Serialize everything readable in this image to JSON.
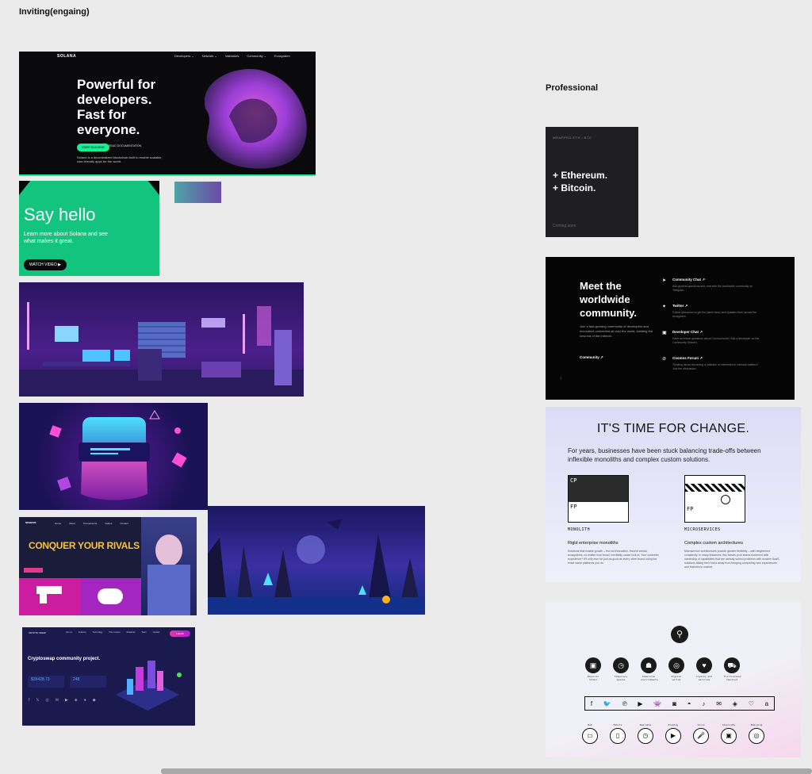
{
  "section_inviting": "Inviting(engaing)",
  "section_professional": "Professional",
  "solana": {
    "brand": "SOLANA",
    "nav": [
      "Developers ⌄",
      "Network ⌄",
      "Validators",
      "Community ⌄",
      "Ecosystem"
    ],
    "headline": "Powerful for developers. Fast for everyone.",
    "btn_primary": "START BUILDING",
    "btn_secondary": "READ DOCUMENTATION",
    "desc": "Solana is a decentralized blockchain built to enable scalable, user-friendly apps for the world."
  },
  "hello": {
    "title": "Say hello",
    "desc": "Learn more about Solana and see what makes it great.",
    "button": "WATCH VIDEO ▶"
  },
  "conquer": {
    "brand": "NEMESIS",
    "nav": [
      "Home",
      "About",
      "Tournaments",
      "Videos",
      "Contact"
    ],
    "title": "CONQUER YOUR RIVALS"
  },
  "crypto": {
    "brand": "CRYPTO SWAP",
    "nav": [
      "Join us",
      "Features",
      "Technology",
      "How it works",
      "Roadmap",
      "Team",
      "Contact"
    ],
    "btn": "Launch",
    "title": "Cryptoswap community project.",
    "price_value": "$39428.73",
    "pool_value": "248",
    "socials": [
      "f",
      "𝕏",
      "◎",
      "✉",
      "▶",
      "◈",
      "●",
      "◆"
    ]
  },
  "wrapped": {
    "label": "WRAPPED ETH / BTC",
    "line1": "+ Ethereum.",
    "line2": "+ Bitcoin.",
    "soon": "Coming soon"
  },
  "meet": {
    "title": "Meet the worldwide community.",
    "desc": "Join a fast-growing community of developers and innovators connected all over the world, building the new era of the internet.",
    "link": "Community ↗",
    "items": [
      {
        "title": "Community Chat ↗",
        "desc": "Ask general questions and chat with the worldwide community on Telegram."
      },
      {
        "title": "Twitter ↗",
        "desc": "Follow @cosmos to get the latest news and updates from across the ecosystem."
      },
      {
        "title": "Developer Chat ↗",
        "desc": "Have technical questions about Cosmos tools? Ask a developer on the Community Discord."
      },
      {
        "title": "Cosmos Forum ↗",
        "desc": "Thinking about becoming a validator or interested in network matters? Join the discussion."
      }
    ]
  },
  "change": {
    "title": "IT'S TIME FOR CHANGE.",
    "desc": "For years, businesses have been stuck balancing trade-offs between inflexible monoliths and complex custom solutions.",
    "cp": "CP",
    "fp": "FP",
    "monolith": "MONOLITH",
    "micro": "MICROSERVICES",
    "sub1": "Rigid enterprise monoliths",
    "sub2": "Complex custom architectures",
    "txt1": "Solutions that enable growth – but not innovation. Havent vendor ecosystems, no matter how broad, inevitably cause lock-in. Your customer experience? It'll only ever be just as good as every other brand using the exact same platforms you do.",
    "txt2": "Microservice architectures provide greater flexibility – with heightened complexity. In many instances, this leaves your teams burdened with ownership of capabilities that are already solved problems with modern SaaS solutions taking their focus away from bringing compelling new experiences and features to market."
  },
  "icons_card": {
    "row1": [
      {
        "icon": "▣",
        "label": "Physical retail"
      },
      {
        "icon": "◷",
        "label": "Temporary spaces"
      },
      {
        "icon": "☗",
        "label": "Immersive environments"
      },
      {
        "icon": "◎",
        "label": "Digital worlds"
      },
      {
        "icon": "♥",
        "label": "Loyalty and services"
      },
      {
        "icon": "⛟",
        "label": "Frictionless checkout"
      }
    ],
    "socials": [
      "f",
      "🐦",
      "℗",
      "▶",
      "👾",
      "◙",
      "◓",
      "♪",
      "✉",
      "◈",
      "♡",
      "a"
    ],
    "row2": [
      {
        "icon": "▭",
        "label": "Web"
      },
      {
        "icon": "▯",
        "label": "Mobile"
      },
      {
        "icon": "◷",
        "label": "Wearable"
      },
      {
        "icon": "▶",
        "label": "Display"
      },
      {
        "icon": "🎤",
        "label": "Voice"
      },
      {
        "icon": "▣",
        "label": "Associate"
      },
      {
        "icon": "◎",
        "label": "Emerging"
      }
    ]
  }
}
